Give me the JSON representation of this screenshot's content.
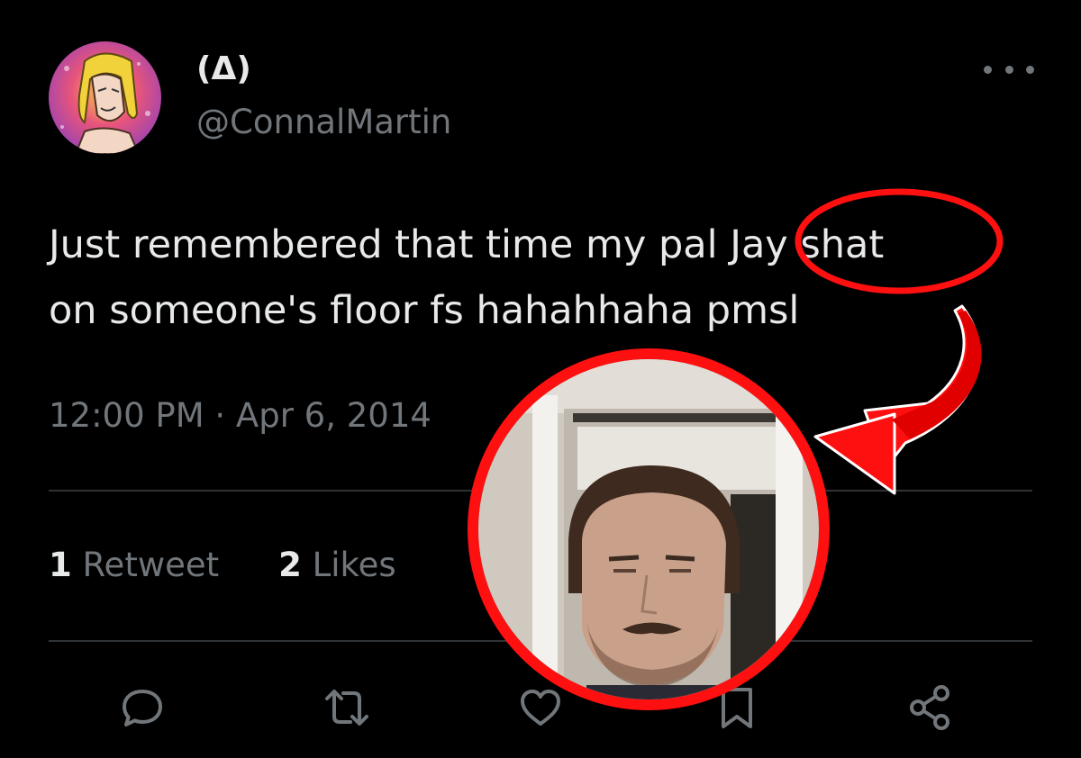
{
  "author": {
    "display_name": "(Δ)",
    "handle": "@ConnalMartin",
    "avatar_icon": "cartoon-avatar-icon"
  },
  "tweet": {
    "text_line1": "Just remembered that time my pal Jay shat",
    "text_line2": "on someone's floor fs hahahhaha pmsl",
    "timestamp": "12:00 PM · Apr 6, 2014"
  },
  "stats": {
    "retweets_count": "1",
    "retweets_label": "Retweet",
    "likes_count": "2",
    "likes_label": "Likes"
  },
  "actions": [
    {
      "name": "reply",
      "icon": "comment-icon"
    },
    {
      "name": "retweet",
      "icon": "retweet-icon"
    },
    {
      "name": "like",
      "icon": "heart-icon"
    },
    {
      "name": "bookmark",
      "icon": "bookmark-icon"
    },
    {
      "name": "share",
      "icon": "share-icon"
    }
  ],
  "colors": {
    "background": "#000000",
    "text_primary": "#e7e9ea",
    "text_secondary": "#71767b",
    "divider": "#2f3336",
    "annotation_red": "#ff1010"
  },
  "annotation": {
    "highlight_icon": "red-ellipse-highlight",
    "arrow_icon": "red-curved-arrow-icon",
    "photo": "face-photo-in-red-circle"
  }
}
